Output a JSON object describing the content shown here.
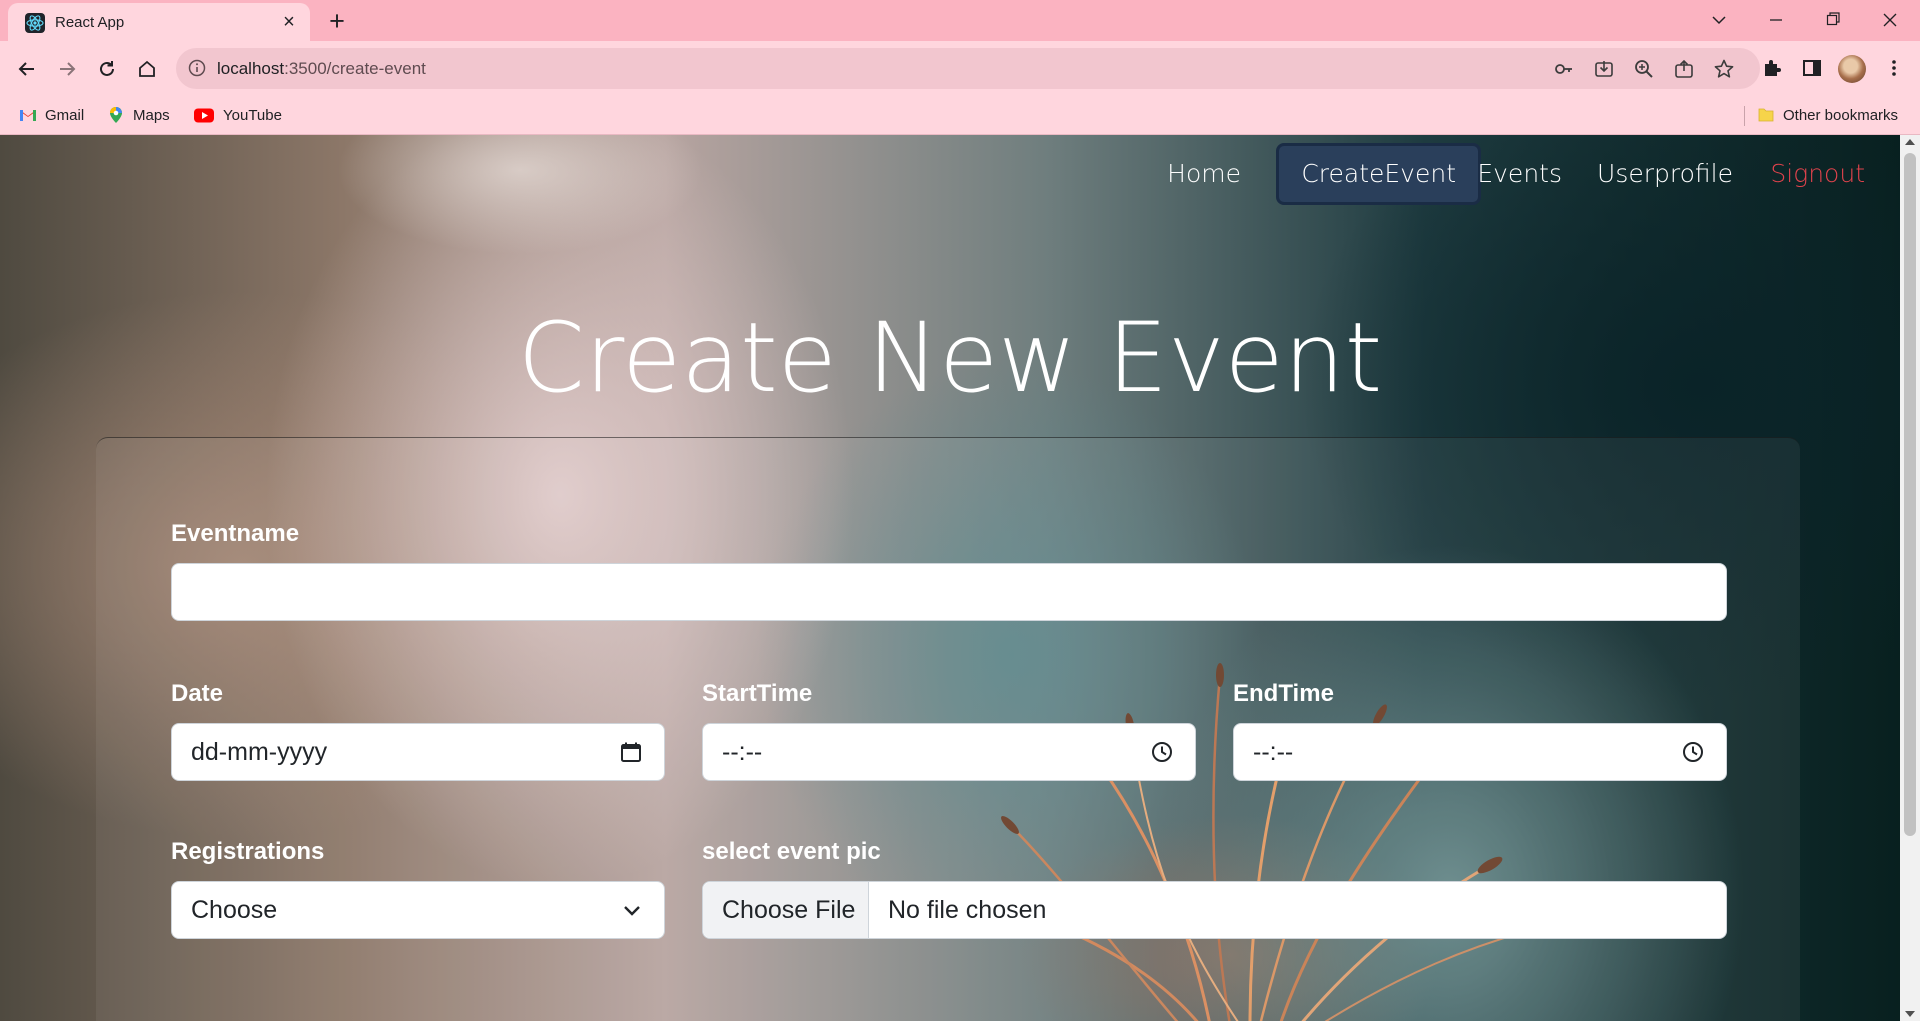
{
  "browser": {
    "tab_title": "React App",
    "tab_close": "×",
    "new_tab": "+",
    "url_host": "localhost",
    "url_path": ":3500/create-event",
    "bookmarks": [
      {
        "label": "Gmail",
        "icon": "gmail-icon"
      },
      {
        "label": "Maps",
        "icon": "maps-icon"
      },
      {
        "label": "YouTube",
        "icon": "youtube-icon"
      }
    ],
    "other_bookmarks": "Other bookmarks"
  },
  "nav": {
    "home": "Home",
    "create_event": "CreateEvent",
    "events": "Events",
    "userprofile": "Userprofile",
    "signout": "Signout",
    "active_color": "#2a3f5b",
    "signout_color": "#e0434c"
  },
  "page": {
    "title": "Create New Event"
  },
  "form": {
    "eventname_label": "Eventname",
    "eventname_value": "",
    "date_label": "Date",
    "date_placeholder": "dd-mm-yyyy",
    "starttime_label": "StartTime",
    "starttime_placeholder": "--:--",
    "endtime_label": "EndTime",
    "endtime_placeholder": "--:--",
    "registrations_label": "Registrations",
    "registrations_selected": "Choose",
    "pic_label": "select event pic",
    "file_button": "Choose File",
    "file_status": "No file chosen"
  }
}
